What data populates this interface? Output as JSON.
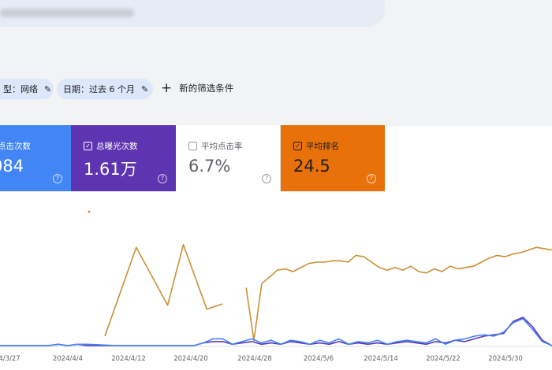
{
  "filters": {
    "type_chip": {
      "label": "型：网络"
    },
    "date_chip": {
      "label": "日期：过去 6 个月"
    },
    "new_filter_label": "新的筛选条件"
  },
  "metrics": {
    "clicks": {
      "label": "点击次数",
      "value": "084",
      "checked": true
    },
    "impressions": {
      "label": "总曝光次数",
      "value": "1.61万",
      "checked": true
    },
    "ctr": {
      "label": "平均点击率",
      "value": "6.7%",
      "checked": false
    },
    "position": {
      "label": "平均排名",
      "value": "24.5",
      "checked": true
    }
  },
  "colors": {
    "clicks": "#4285f4",
    "impressions": "#5e35b1",
    "position": "#e8710a",
    "position_line": "#c98f35"
  },
  "icons": {
    "pencil": "pencil-icon",
    "plus": "plus-icon",
    "help": "help-icon",
    "checkbox": "checkbox-icon"
  },
  "chart_data": {
    "type": "line",
    "x_ticks": [
      "4/3/27",
      "2024/4/4",
      "2024/4/12",
      "2024/4/20",
      "2024/4/28",
      "2024/5/6",
      "2024/5/14",
      "2024/5/22",
      "2024/5/30"
    ],
    "grid": false,
    "series": [
      {
        "key": "position",
        "points": [
          [
            0,
            0.93
          ],
          [
            4,
            0.27
          ],
          [
            8,
            0.7
          ],
          [
            10,
            0.25
          ],
          [
            13,
            0.73
          ],
          [
            15,
            0.69
          ],
          [
            null,
            null
          ],
          [
            18,
            0.57
          ],
          [
            19,
            0.96
          ],
          [
            20,
            0.54
          ],
          [
            21,
            0.49
          ],
          [
            22,
            0.44
          ],
          [
            23,
            0.43
          ],
          [
            24,
            0.45
          ],
          [
            25,
            0.42
          ],
          [
            26,
            0.39
          ],
          [
            27,
            0.38
          ],
          [
            28,
            0.38
          ],
          [
            29,
            0.37
          ],
          [
            30,
            0.37
          ],
          [
            31,
            0.38
          ],
          [
            32,
            0.33
          ],
          [
            33,
            0.34
          ],
          [
            34,
            0.38
          ],
          [
            35,
            0.42
          ],
          [
            36,
            0.44
          ],
          [
            37,
            0.42
          ],
          [
            38,
            0.44
          ],
          [
            39,
            0.41
          ],
          [
            40,
            0.45
          ],
          [
            41,
            0.46
          ],
          [
            42,
            0.43
          ],
          [
            43,
            0.45
          ],
          [
            44,
            0.41
          ],
          [
            45,
            0.43
          ],
          [
            46,
            0.42
          ],
          [
            47,
            0.41
          ],
          [
            48,
            0.38
          ],
          [
            49,
            0.35
          ],
          [
            50,
            0.33
          ],
          [
            51,
            0.34
          ],
          [
            52,
            0.32
          ],
          [
            53,
            0.31
          ],
          [
            54,
            0.29
          ],
          [
            55,
            0.27
          ],
          [
            56,
            0.28
          ],
          [
            57,
            0.29
          ]
        ]
      },
      {
        "key": "impressions",
        "points": [
          [
            0,
            1.0
          ],
          [
            5,
            1.0
          ],
          [
            6,
            0.99
          ],
          [
            7,
            1.0
          ],
          [
            8,
            0.99
          ],
          [
            9,
            1.0
          ],
          [
            12,
            1.0
          ],
          [
            16,
            1.0
          ],
          [
            20,
            1.0
          ],
          [
            21,
            0.98
          ],
          [
            22,
            0.97
          ],
          [
            23,
            0.97
          ],
          [
            24,
            0.99
          ],
          [
            25,
            0.98
          ],
          [
            26,
            0.97
          ],
          [
            27,
            0.99
          ],
          [
            28,
            0.98
          ],
          [
            29,
            0.99
          ],
          [
            30,
            0.97
          ],
          [
            31,
            0.98
          ],
          [
            32,
            0.99
          ],
          [
            33,
            0.98
          ],
          [
            34,
            0.99
          ],
          [
            35,
            0.97
          ],
          [
            36,
            0.99
          ],
          [
            37,
            0.98
          ],
          [
            38,
            0.99
          ],
          [
            39,
            0.98
          ],
          [
            40,
            0.99
          ],
          [
            41,
            0.98
          ],
          [
            42,
            0.97
          ],
          [
            43,
            0.98
          ],
          [
            44,
            0.99
          ],
          [
            45,
            0.97
          ],
          [
            46,
            0.98
          ],
          [
            47,
            0.96
          ],
          [
            48,
            0.97
          ],
          [
            49,
            0.95
          ],
          [
            50,
            0.93
          ],
          [
            51,
            0.92
          ],
          [
            52,
            0.91
          ],
          [
            53,
            0.82
          ],
          [
            54,
            0.79
          ],
          [
            55,
            0.86
          ],
          [
            56,
            0.96
          ],
          [
            57,
            1.0
          ]
        ]
      },
      {
        "key": "clicks",
        "points": [
          [
            0,
            1.0
          ],
          [
            5,
            1.0
          ],
          [
            6,
            0.99
          ],
          [
            7,
            1.0
          ],
          [
            8,
            0.99
          ],
          [
            9,
            0.99
          ],
          [
            12,
            1.0
          ],
          [
            16,
            1.0
          ],
          [
            20,
            1.0
          ],
          [
            21,
            0.98
          ],
          [
            22,
            0.95
          ],
          [
            23,
            0.95
          ],
          [
            24,
            0.99
          ],
          [
            25,
            0.97
          ],
          [
            26,
            0.95
          ],
          [
            27,
            0.98
          ],
          [
            28,
            0.96
          ],
          [
            29,
            0.99
          ],
          [
            30,
            0.96
          ],
          [
            31,
            0.97
          ],
          [
            32,
            0.99
          ],
          [
            33,
            0.96
          ],
          [
            34,
            0.98
          ],
          [
            35,
            0.95
          ],
          [
            36,
            0.99
          ],
          [
            37,
            0.97
          ],
          [
            38,
            0.98
          ],
          [
            39,
            0.96
          ],
          [
            40,
            0.99
          ],
          [
            41,
            0.97
          ],
          [
            42,
            0.96
          ],
          [
            43,
            0.97
          ],
          [
            44,
            0.98
          ],
          [
            45,
            0.95
          ],
          [
            46,
            0.99
          ],
          [
            47,
            0.96
          ],
          [
            48,
            0.95
          ],
          [
            49,
            0.93
          ],
          [
            50,
            0.92
          ],
          [
            51,
            0.93
          ],
          [
            52,
            0.9
          ],
          [
            53,
            0.83
          ],
          [
            54,
            0.8
          ],
          [
            55,
            0.88
          ],
          [
            56,
            0.97
          ],
          [
            57,
            1.0
          ]
        ]
      }
    ],
    "xrange": [
      0,
      57
    ]
  }
}
